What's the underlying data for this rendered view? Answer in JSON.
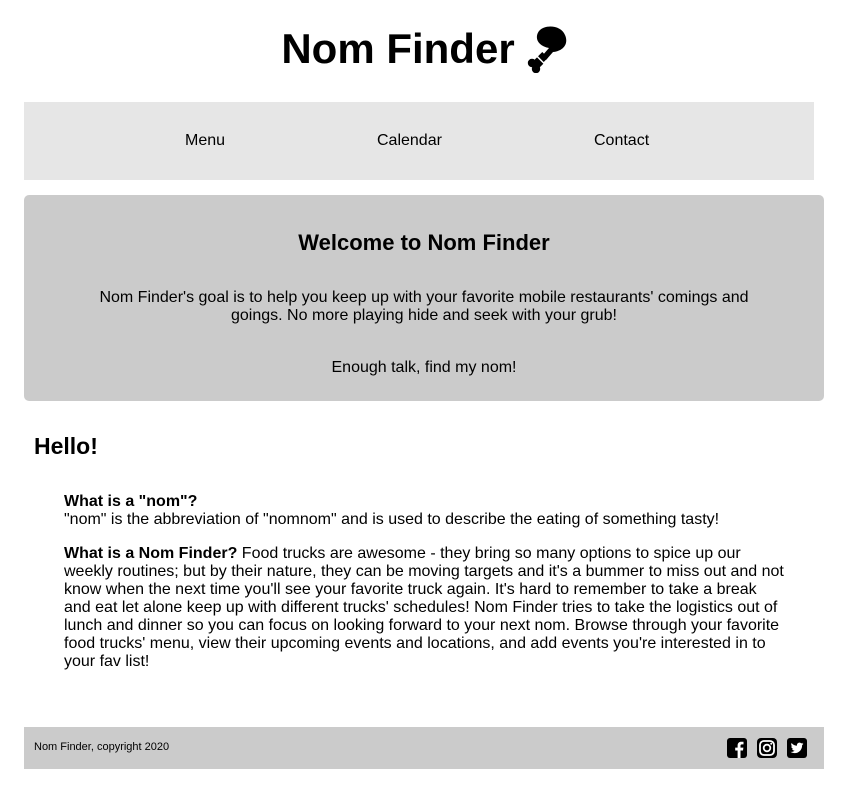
{
  "header": {
    "title": "Nom Finder",
    "logo_icon": "drumstick-icon"
  },
  "nav": {
    "items": [
      {
        "label": "Menu"
      },
      {
        "label": "Calendar"
      },
      {
        "label": "Contact"
      }
    ]
  },
  "hero": {
    "heading": "Welcome to Nom Finder",
    "description": "Nom Finder's goal is to help you keep up with your favorite mobile restaurants' comings and goings. No more playing hide and seek with your grub!",
    "cta": "Enough talk, find my nom!"
  },
  "main": {
    "greeting": "Hello!",
    "faq": [
      {
        "question": "What is a \"nom\"?",
        "answer": "\"nom\" is the abbreviation of \"nomnom\" and is used to describe the eating of something tasty!"
      },
      {
        "question": "What is a Nom Finder?",
        "answer": "Food trucks are awesome - they bring so many options to spice up our weekly routines; but by their nature, they can be moving targets and it's a bummer to miss out and not know when the next time you'll see your favorite truck again. It's hard to remember to take a break and eat let alone keep up with different trucks' schedules! Nom Finder tries to take the logistics out of lunch and dinner so you can focus on looking forward to your next nom. Browse through your favorite food trucks' menu, view their upcoming events and locations, and add events you're interested in to your fav list!"
      }
    ]
  },
  "footer": {
    "copyright": "Nom Finder, copyright 2020",
    "social": [
      {
        "icon": "facebook-icon"
      },
      {
        "icon": "instagram-icon"
      },
      {
        "icon": "twitter-icon"
      }
    ]
  }
}
